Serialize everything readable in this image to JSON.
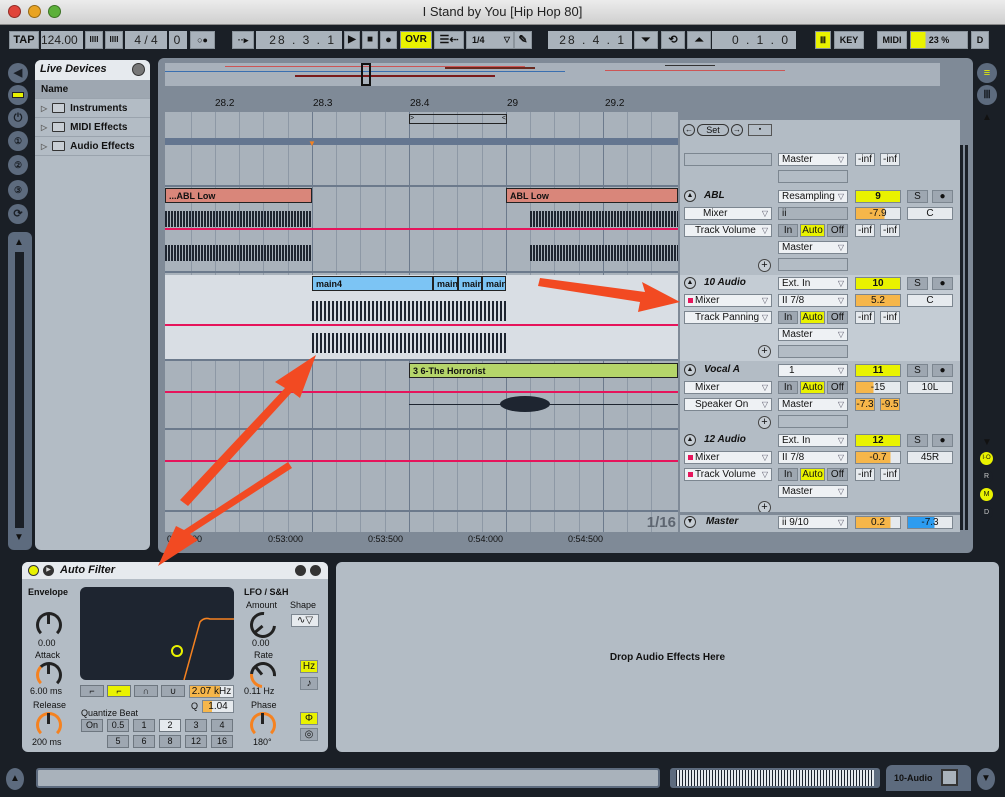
{
  "window": {
    "title": "I Stand by You  [Hip Hop 80]"
  },
  "transport": {
    "tap": "TAP",
    "tempo": "124.00",
    "nudge_down": "IIII",
    "nudge_up": "IIII",
    "signature": "4 / 4",
    "metronome": "0",
    "quant_dots": "○●",
    "follow": "··▸",
    "position": "28 .  3 .  1",
    "play": "▶",
    "stop": "■",
    "record": "●",
    "overdub": "OVR",
    "back_to_arr": "☰⇠",
    "quantization": "1/4",
    "draw_mode": "✎",
    "loop_start": "28 .  4 .  1",
    "punch_in": "⏷",
    "loop": "⟲",
    "punch_out": "⏶",
    "loop_length": "0 .  1 .  0",
    "computer_midi": "Ⅲ",
    "key": "KEY",
    "midi": "MIDI",
    "cpu": "23 %",
    "disk": "D"
  },
  "browser": {
    "title": "Live Devices",
    "column": "Name",
    "items": [
      {
        "label": "Instruments"
      },
      {
        "label": "MIDI Effects"
      },
      {
        "label": "Audio Effects"
      }
    ]
  },
  "sidebar": {
    "icons": [
      "back",
      "live-devices",
      "plugin",
      "place-1",
      "place-2",
      "place-3",
      "refresh"
    ]
  },
  "arrangement": {
    "ruler": [
      "28.2",
      "28.3",
      "28.4",
      "29",
      "29.2"
    ],
    "time_ruler": [
      "0:52:500",
      "0:53:000",
      "0:53:500",
      "0:54:000",
      "0:54:500"
    ],
    "grid": "1/16",
    "clips": {
      "abl_left": "...ABL Low",
      "abl_right": "ABL Low",
      "main": [
        "main4",
        "main",
        "main",
        "main"
      ],
      "vocal": "3 6-The Horrorist"
    },
    "locators": {
      "set": "Set",
      "prev": "←",
      "next": "→",
      "lock": "🔒"
    }
  },
  "tracks": [
    {
      "name": "",
      "device": "",
      "param": "",
      "input": "",
      "monitor": "",
      "output": "Master",
      "number": "",
      "volume": "",
      "pan": "",
      "peak_l": "-inf",
      "peak_r": "-inf"
    },
    {
      "name": "ABL",
      "device": "Mixer",
      "param": "Track Volume",
      "input": "Resampling",
      "chan": "ii",
      "output": "Master",
      "number": "9",
      "volume": "-7.9",
      "pan": "C",
      "peak_l": "-inf",
      "peak_r": "-inf",
      "mon": [
        "In",
        "Auto",
        "Off"
      ]
    },
    {
      "name": "10 Audio",
      "device": "Mixer",
      "param": "Track Panning",
      "input": "Ext. In",
      "chan": "II 7/8",
      "output": "Master",
      "number": "10",
      "volume": "5.2",
      "pan": "C",
      "peak_l": "-inf",
      "peak_r": "-inf",
      "mon": [
        "In",
        "Auto",
        "Off"
      ]
    },
    {
      "name": "Vocal A",
      "device": "Mixer",
      "param": "Speaker On",
      "input": "1",
      "output": "Master",
      "number": "11",
      "volume": "-15",
      "pan": "10L",
      "peak_l": "-7.3",
      "peak_r": "-9.5",
      "mon": [
        "In",
        "Auto",
        "Off"
      ]
    },
    {
      "name": "12 Audio",
      "device": "Mixer",
      "param": "Track Volume",
      "input": "Ext. In",
      "chan": "II 7/8",
      "output": "Master",
      "number": "12",
      "volume": "-0.7",
      "pan": "45R",
      "peak_l": "-inf",
      "peak_r": "-inf",
      "mon": [
        "In",
        "Auto",
        "Off"
      ]
    }
  ],
  "master": {
    "name": "Master",
    "chan": "ii 9/10",
    "volume": "0.2",
    "pan": "-7.3"
  },
  "solo": "S",
  "arm": "●",
  "right_toggles": [
    "I·O",
    "R",
    "M",
    "D"
  ],
  "device": {
    "name": "Auto Filter",
    "envelope": {
      "title": "Envelope",
      "amount": "0.00",
      "attack_label": "Attack",
      "attack": "6.00 ms",
      "release_label": "Release",
      "release": "200 ms"
    },
    "filter": {
      "freq": "2.07 kHz",
      "q_label": "Q",
      "q": "1.04",
      "types": [
        "lowpass",
        "highpass",
        "bandpass",
        "notch"
      ],
      "selected_type": "highpass"
    },
    "quantize": {
      "label": "Quantize Beat",
      "on": "On",
      "values": [
        "0.5",
        "1",
        "2",
        "3",
        "4",
        "5",
        "6",
        "8",
        "12",
        "16"
      ],
      "selected": "2"
    },
    "lfo": {
      "title": "LFO / S&H",
      "amount_label": "Amount",
      "amount": "0.00",
      "shape_label": "Shape",
      "rate_label": "Rate",
      "rate": "0.11 Hz",
      "phase_label": "Phase",
      "phase": "180°",
      "hz": "Hz",
      "sync": "♪",
      "phi": "Φ",
      "spin": "◎"
    }
  },
  "drop_area": "Drop Audio Effects Here",
  "status": {
    "selected_track": "10-Audio"
  }
}
